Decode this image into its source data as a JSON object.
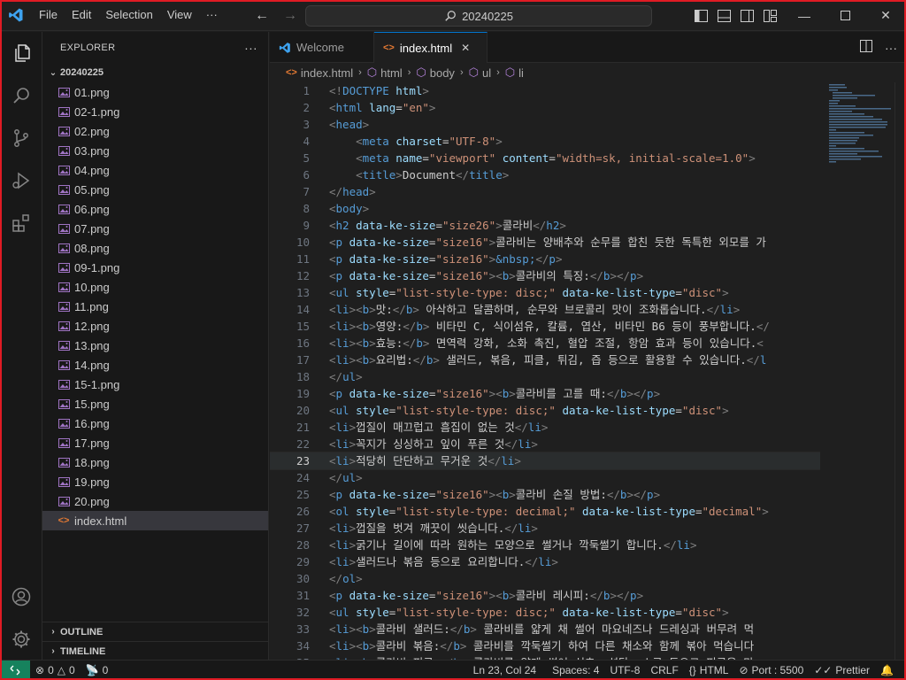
{
  "menu": [
    "File",
    "Edit",
    "Selection",
    "View",
    "···"
  ],
  "search": {
    "text": "20240225"
  },
  "explorer": {
    "title": "EXPLORER",
    "more": "···",
    "folder": "20240225",
    "files": [
      "01.png",
      "02-1.png",
      "02.png",
      "03.png",
      "04.png",
      "05.png",
      "06.png",
      "07.png",
      "08.png",
      "09-1.png",
      "10.png",
      "11.png",
      "12.png",
      "13.png",
      "14.png",
      "15-1.png",
      "15.png",
      "16.png",
      "17.png",
      "18.png",
      "19.png",
      "20.png"
    ],
    "active_file": "index.html",
    "outline": "OUTLINE",
    "timeline": "TIMELINE"
  },
  "tabs": [
    {
      "label": "Welcome",
      "active": false
    },
    {
      "label": "index.html",
      "active": true
    }
  ],
  "breadcrumb": [
    "index.html",
    "html",
    "body",
    "ul",
    "li"
  ],
  "editor": {
    "current_line": 23,
    "lines": [
      "<!DOCTYPE html>",
      "<html lang=\"en\">",
      "<head>",
      "    <meta charset=\"UTF-8\">",
      "    <meta name=\"viewport\" content=\"width=sk, initial-scale=1.0\">",
      "    <title>Document</title>",
      "</head>",
      "<body>",
      "<h2 data-ke-size=\"size26\">콜라비</h2>",
      "<p data-ke-size=\"size16\">콜라비는 양배추와 순무를 합친 듯한 독특한 외모를 가",
      "<p data-ke-size=\"size16\">&nbsp;</p>",
      "<p data-ke-size=\"size16\"><b>콜라비의 특징:</b></p>",
      "<ul style=\"list-style-type: disc;\" data-ke-list-type=\"disc\">",
      "<li><b>맛:</b> 아삭하고 달콤하며, 순무와 브로콜리 맛이 조화롭습니다.</li>",
      "<li><b>영양:</b> 비타민 C, 식이섬유, 칼륨, 엽산, 비타민 B6 등이 풍부합니다.</",
      "<li><b>효능:</b> 면역력 강화, 소화 촉진, 혈압 조절, 항암 효과 등이 있습니다.<",
      "<li><b>요리법:</b> 샐러드, 볶음, 피클, 튀김, 즙 등으로 활용할 수 있습니다.</l",
      "</ul>",
      "<p data-ke-size=\"size16\"><b>콜라비를 고를 때:</b></p>",
      "<ul style=\"list-style-type: disc;\" data-ke-list-type=\"disc\">",
      "<li>껍질이 매끄럽고 흠집이 없는 것</li>",
      "<li>꼭지가 싱싱하고 잎이 푸른 것</li>",
      "<li>적당히 단단하고 무거운 것</li>",
      "</ul>",
      "<p data-ke-size=\"size16\"><b>콜라비 손질 방법:</b></p>",
      "<ol style=\"list-style-type: decimal;\" data-ke-list-type=\"decimal\">",
      "<li>껍질을 벗겨 깨끗이 씻습니다.</li>",
      "<li>굵기나 길이에 따라 원하는 모양으로 썰거나 깍둑썰기 합니다.</li>",
      "<li>샐러드나 볶음 등으로 요리합니다.</li>",
      "</ol>",
      "<p data-ke-size=\"size16\"><b>콜라비 레시피:</b></p>",
      "<ul style=\"list-style-type: disc;\" data-ke-list-type=\"disc\">",
      "<li><b>콜라비 샐러드:</b> 콜라비를 얇게 채 썰어 마요네즈나 드레싱과 버무려 먹",
      "<li><b>콜라비 볶음:</b> 콜라비를 깍둑썰기 하여 다른 채소와 함께 볶아 먹습니다",
      "<li><b>콜라비 피클:</b> 콜라비를 얇게 썰어 식초, 설탕, 소금 등으로 피클을 만"
    ]
  },
  "status": {
    "errors": "0",
    "warnings": "0",
    "ports": "0",
    "position": "Ln 23, Col 24",
    "spaces": "Spaces: 4",
    "encoding": "UTF-8",
    "eol": "CRLF",
    "language": "HTML",
    "port": "Port : 5500",
    "formatter": "Prettier"
  },
  "colors": {
    "accent": "#0078d4",
    "remote": "#16825d",
    "tag": "#569cd6",
    "attr": "#9cdcfe",
    "string": "#ce9178"
  }
}
